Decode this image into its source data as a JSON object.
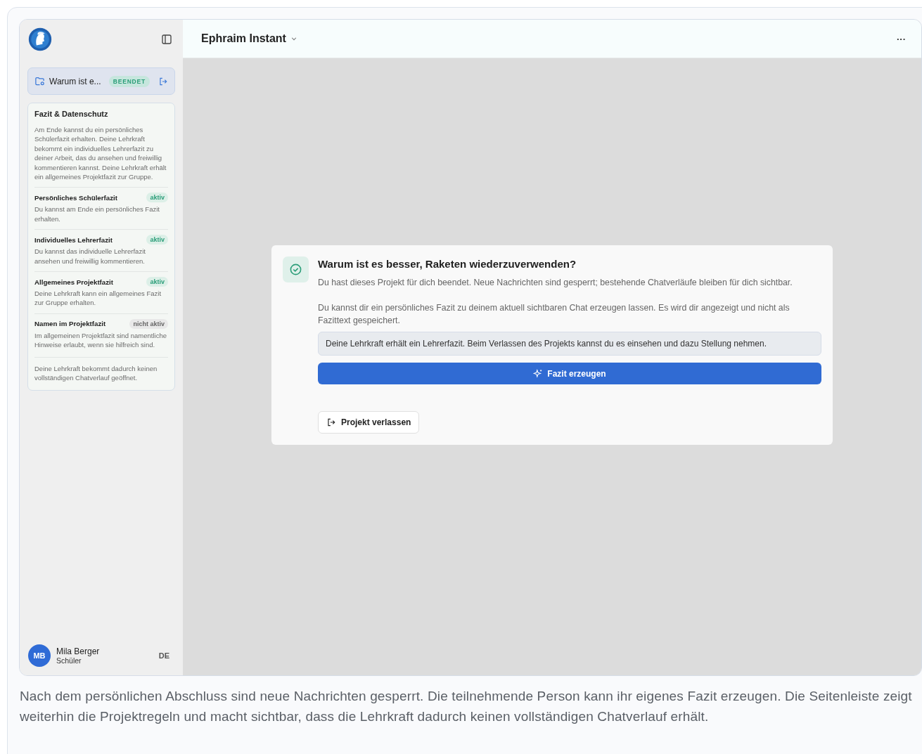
{
  "sidebar": {
    "project": {
      "title": "Warum ist e...",
      "status": "BEENDET"
    },
    "rules": {
      "title": "Fazit & Datenschutz",
      "intro": "Am Ende kannst du ein persönliches Schülerfazit erhalten. Deine Lehrkraft bekommt ein individuelles Lehrerfazit zu deiner Arbeit, das du ansehen und freiwillig kommentieren kannst. Deine Lehrkraft erhält ein allgemeines Projektfazit zur Gruppe.",
      "items": [
        {
          "title": "Persönliches Schülerfazit",
          "badge": "aktiv",
          "active": true,
          "text": "Du kannst am Ende ein persönliches Fazit erhalten."
        },
        {
          "title": "Individuelles Lehrerfazit",
          "badge": "aktiv",
          "active": true,
          "text": "Du kannst das individuelle Lehrerfazit ansehen und freiwillig kommentieren."
        },
        {
          "title": "Allgemeines Projektfazit",
          "badge": "aktiv",
          "active": true,
          "text": "Deine Lehrkraft kann ein allgemeines Fazit zur Gruppe erhalten."
        },
        {
          "title": "Namen im Projektfazit",
          "badge": "nicht aktiv",
          "active": false,
          "text": "Im allgemeinen Projektfazit sind namentliche Hinweise erlaubt, wenn sie hilfreich sind."
        }
      ],
      "footer": "Deine Lehrkraft bekommt dadurch keinen vollständigen Chatverlauf geöffnet."
    },
    "user": {
      "initials": "MB",
      "name": "Mila Berger",
      "role": "Schüler",
      "language": "DE"
    }
  },
  "header": {
    "model": "Ephraim Instant",
    "menu": "···"
  },
  "notice": {
    "title": "Warum ist es besser, Raketen wiederzuverwenden?",
    "paragraphs": [
      "Du hast dieses Projekt für dich beendet. Neue Nachrichten sind gesperrt; bestehende Chatverläufe bleiben für dich sichtbar.",
      "Du kannst dir ein persönliches Fazit zu deinem aktuell sichtbaren Chat erzeugen lassen. Es wird dir angezeigt und nicht als Fazittext gespeichert."
    ],
    "info": "Deine Lehrkraft erhält ein Lehrerfazit. Beim Verlassen des Projekts kannst du es einsehen und dazu Stellung nehmen.",
    "primary_button": "Fazit erzeugen",
    "secondary_button": "Projekt verlassen"
  },
  "caption": "Nach dem persönlichen Abschluss sind neue Nachrichten gesperrt. Die teilnehmende Person kann ihr eigenes Fazit erzeugen. Die Seitenleiste zeigt weiterhin die Projektregeln und macht sichtbar, dass die Lehrkraft dadurch keinen vollständigen Chatverlauf erhält."
}
